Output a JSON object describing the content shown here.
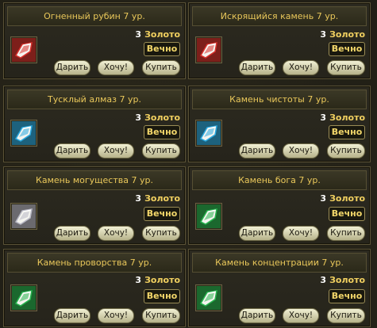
{
  "labels": {
    "gift": "Дарить",
    "want": "Хочу!",
    "buy": "Купить"
  },
  "items": [
    {
      "title": "Огненный рубин 7 ур.",
      "amount": "3",
      "currency": "Золото",
      "duration": "Вечно",
      "icon": "ruby-gem-icon",
      "color": "#d8302a"
    },
    {
      "title": "Искрящийся камень 7 ур.",
      "amount": "3",
      "currency": "Золото",
      "duration": "Вечно",
      "icon": "sparkling-gem-icon",
      "color": "#d8302a"
    },
    {
      "title": "Тусклый алмаз 7 ур.",
      "amount": "3",
      "currency": "Золото",
      "duration": "Вечно",
      "icon": "diamond-gem-icon",
      "color": "#2aa9e0"
    },
    {
      "title": "Камень чистоты 7 ур.",
      "amount": "3",
      "currency": "Золото",
      "duration": "Вечно",
      "icon": "purity-gem-icon",
      "color": "#2aa9e0"
    },
    {
      "title": "Камень могущества 7 ур.",
      "amount": "3",
      "currency": "Золото",
      "duration": "Вечно",
      "icon": "might-gem-icon",
      "color": "#b8b8c4"
    },
    {
      "title": "Камень бога 7 ур.",
      "amount": "3",
      "currency": "Золото",
      "duration": "Вечно",
      "icon": "god-gem-icon",
      "color": "#27b44e"
    },
    {
      "title": "Камень проворства 7 ур.",
      "amount": "3",
      "currency": "Золото",
      "duration": "Вечно",
      "icon": "agility-gem-icon",
      "color": "#27b44e"
    },
    {
      "title": "Камень концентрации 7 ур.",
      "amount": "3",
      "currency": "Золото",
      "duration": "Вечно",
      "icon": "concentration-gem-icon",
      "color": "#27b44e"
    }
  ]
}
